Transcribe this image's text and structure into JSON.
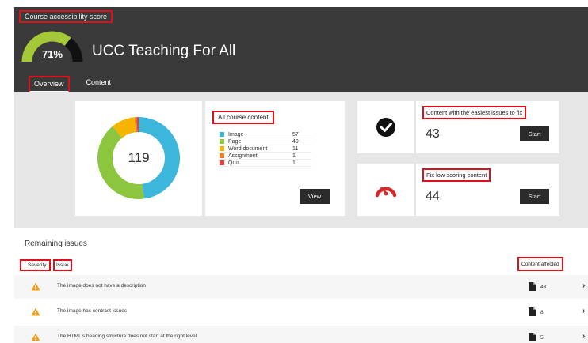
{
  "header": {
    "score_label": "Course accessibility score",
    "score_pct": "71%",
    "score_value": 0.71,
    "title": "UCC Teaching For All",
    "tabs": [
      {
        "label": "Overview",
        "active": true
      },
      {
        "label": "Content",
        "active": false
      }
    ]
  },
  "summary": {
    "total": "119",
    "content_title": "All course content",
    "legend": [
      {
        "label": "Image",
        "value": "57",
        "color": "#3db6dc"
      },
      {
        "label": "Page",
        "value": "49",
        "color": "#8cc63f"
      },
      {
        "label": "Word document",
        "value": "11",
        "color": "#f4b400"
      },
      {
        "label": "Assignment",
        "value": "1",
        "color": "#ef7d22"
      },
      {
        "label": "Quiz",
        "value": "1",
        "color": "#e8413c"
      }
    ],
    "view_label": "View"
  },
  "easy": {
    "title": "Content with the easiest issues to fix",
    "count": "43",
    "button": "Start",
    "icon": "checkmark-circle-icon"
  },
  "low": {
    "title": "Fix low scoring content",
    "count": "44",
    "button": "Start",
    "icon": "speedometer-icon"
  },
  "issues": {
    "title": "Remaining issues",
    "severity_label": "↓ Severity",
    "issue_label": "Issue",
    "affected_label": "Content affected",
    "rows": [
      {
        "text": "The image does not have a description",
        "count": "43"
      },
      {
        "text": "The image has contrast issues",
        "count": "8"
      },
      {
        "text": "The HTML's heading structure does not start at the right level",
        "count": "5"
      }
    ]
  },
  "colors": {
    "header_bg": "#3a3a3a",
    "gauge_fill": "#a5c839",
    "gauge_empty": "#111111",
    "warning": "#f39c12",
    "speedometer": "#d62828",
    "annotation": "#e0101a"
  }
}
